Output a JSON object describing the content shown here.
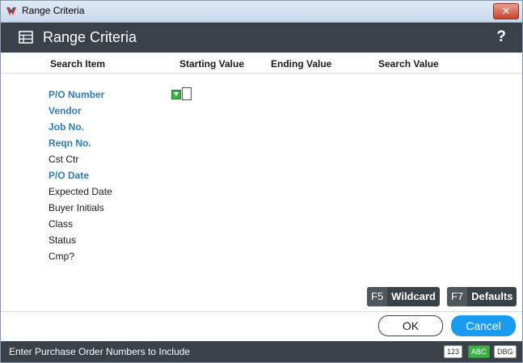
{
  "window": {
    "title": "Range Criteria"
  },
  "header": {
    "title": "Range Criteria",
    "help_glyph": "?"
  },
  "columns": {
    "search_item": "Search Item",
    "starting_value": "Starting Value",
    "ending_value": "Ending Value",
    "search_value": "Search Value"
  },
  "rows": [
    {
      "label": "P/O Number",
      "active": true
    },
    {
      "label": "Vendor",
      "active": true
    },
    {
      "label": "Job No.",
      "active": true
    },
    {
      "label": "Reqn No.",
      "active": true
    },
    {
      "label": "Cst Ctr",
      "active": false
    },
    {
      "label": "P/O Date",
      "active": true
    },
    {
      "label": "Expected Date",
      "active": false
    },
    {
      "label": "Buyer Initials",
      "active": false
    },
    {
      "label": "Class",
      "active": false
    },
    {
      "label": "Status",
      "active": false
    },
    {
      "label": "Cmp?",
      "active": false
    }
  ],
  "starting_input_value": "",
  "fkeys": {
    "wildcard": {
      "key": "F5",
      "label": "Wildcard"
    },
    "defaults": {
      "key": "F7",
      "label": "Defaults"
    }
  },
  "buttons": {
    "ok": "OK",
    "cancel": "Cancel"
  },
  "status": {
    "text": "Enter Purchase Order Numbers to Include",
    "badge_123": "123",
    "badge_abc": "ABC",
    "badge_dbg": "DBG"
  },
  "colors": {
    "active_label": "#2a7cc0",
    "header_bg": "#3a4149",
    "cancel_bg": "#1a9cf0",
    "indicator": "#3cb043"
  }
}
